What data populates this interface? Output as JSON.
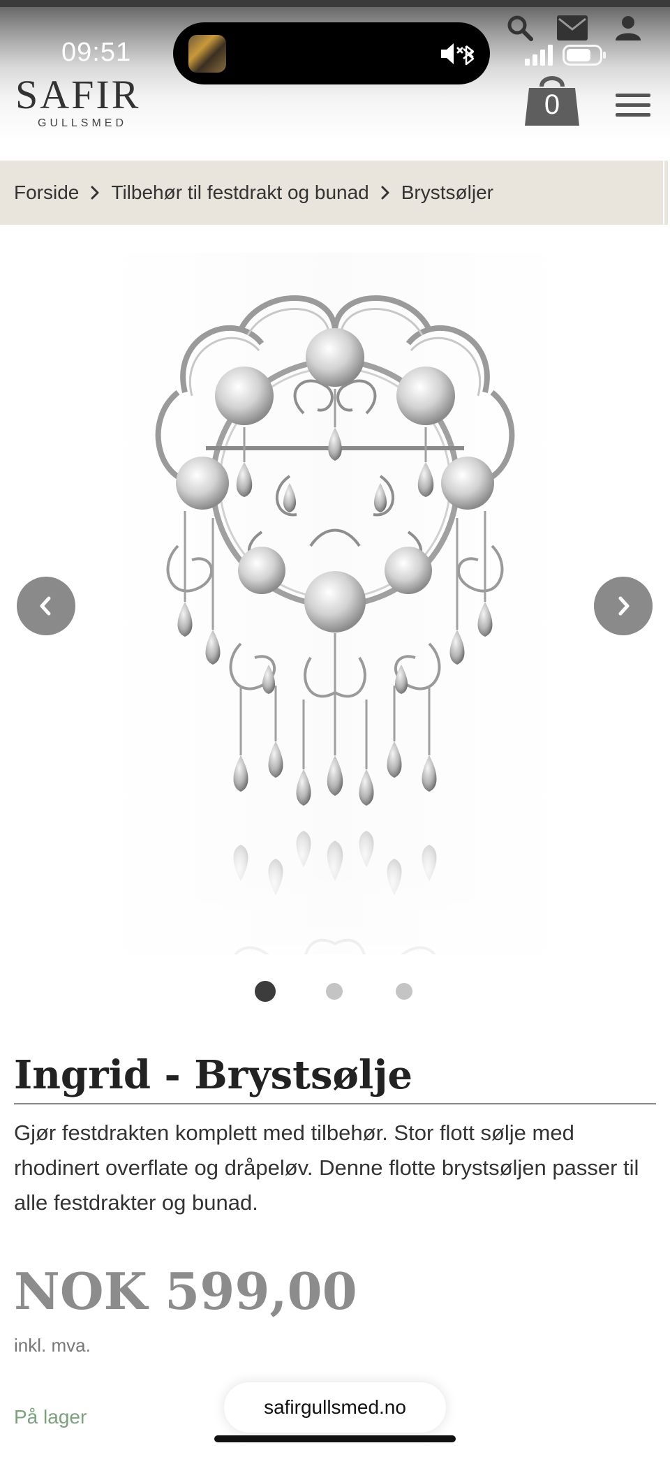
{
  "status_bar": {
    "time": "09:51"
  },
  "header": {
    "logo_main": "SAFIR",
    "logo_sub": "GULLSMED",
    "cart_count": "0",
    "icons": [
      "search-icon",
      "mail-icon",
      "user-icon",
      "cart-icon",
      "menu-icon"
    ]
  },
  "breadcrumb": {
    "items": [
      "Forside",
      "Tilbehør til festdrakt og bunad",
      "Brystsøljer"
    ]
  },
  "gallery": {
    "image_subject": "silver-brooch",
    "slide_count": 3,
    "active_slide": 1
  },
  "product": {
    "title": "Ingrid - Brystsølje",
    "description": "Gjør festdrakten komplett med tilbehør. Stor flott sølje med rhodinert overflate og dråpeløv. Denne flotte brystsøljen passer til alle festdrakter og bunad.",
    "price": "NOK 599,00",
    "vat_note": "inkl. mva.",
    "stock_status": "På lager"
  },
  "browser": {
    "url": "safirgullsmed.no"
  },
  "colors": {
    "breadcrumb_bg": "#e9e4dc",
    "price": "#8c8c8c",
    "stock": "#7aa27a",
    "nav_button": "#8a8a8a"
  }
}
